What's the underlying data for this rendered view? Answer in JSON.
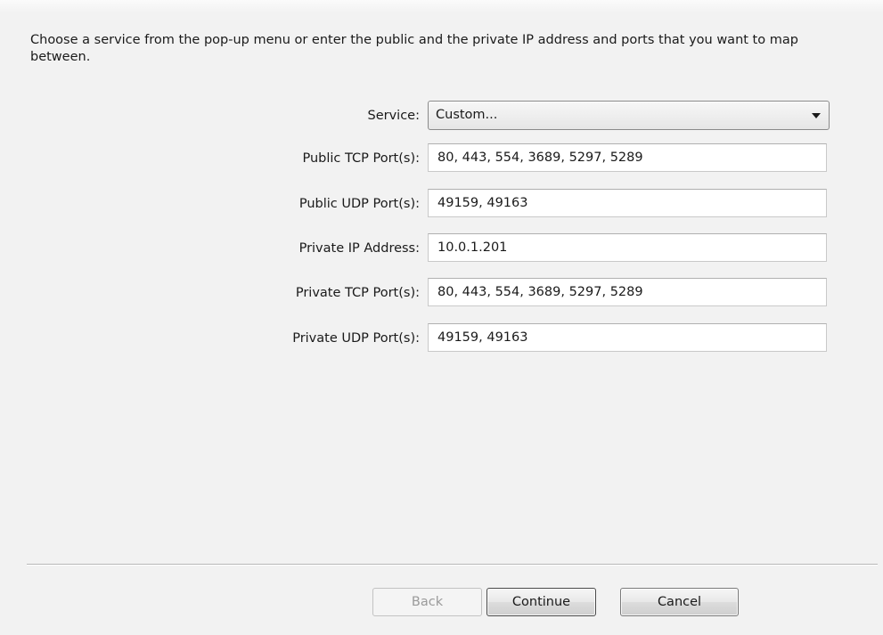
{
  "intro_text": "Choose a service from the pop-up menu or enter the public and the private IP address and ports that you want to map between.",
  "form": {
    "service": {
      "label": "Service:",
      "value": "Custom..."
    },
    "public_tcp": {
      "label": "Public TCP Port(s):",
      "value": "80, 443, 554, 3689, 5297, 5289"
    },
    "public_udp": {
      "label": "Public UDP Port(s):",
      "value": "49159, 49163"
    },
    "private_ip": {
      "label": "Private IP Address:",
      "value": "10.0.1.201"
    },
    "private_tcp": {
      "label": "Private TCP Port(s):",
      "value": "80, 443, 554, 3689, 5297, 5289"
    },
    "private_udp": {
      "label": "Private UDP Port(s):",
      "value": "49159, 49163"
    }
  },
  "buttons": {
    "back": "Back",
    "continue": "Continue",
    "cancel": "Cancel"
  }
}
